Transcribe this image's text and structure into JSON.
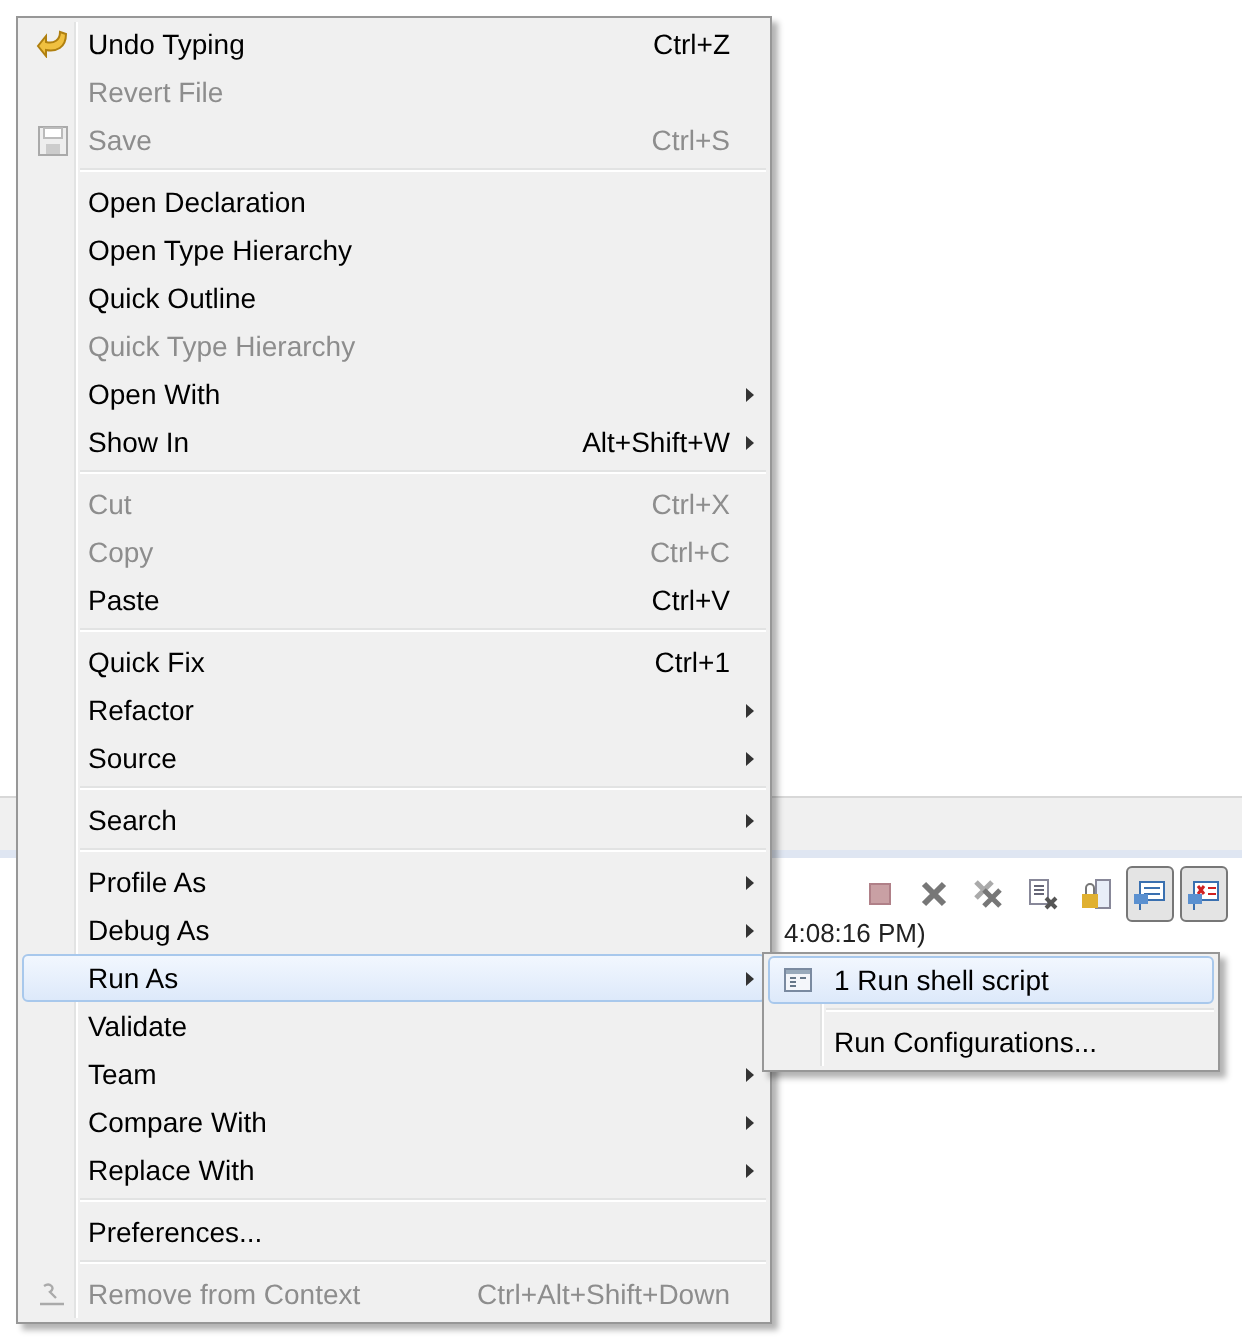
{
  "background": {
    "toolbar": [
      {
        "kind": "stop",
        "selected": false
      },
      {
        "kind": "remove",
        "selected": false
      },
      {
        "kind": "remove-all",
        "selected": false
      },
      {
        "kind": "doc",
        "selected": false
      },
      {
        "kind": "lock",
        "selected": false
      },
      {
        "kind": "console",
        "selected": true
      },
      {
        "kind": "console-error",
        "selected": true
      }
    ],
    "console_text": "4:08:16 PM)"
  },
  "menu": {
    "groups": [
      [
        {
          "label": "Undo Typing",
          "shortcut": "Ctrl+Z",
          "disabled": false,
          "submenu": false,
          "selected": false,
          "kind": "undo"
        },
        {
          "label": "Revert File",
          "disabled": true,
          "submenu": false,
          "selected": false,
          "kind": "plain"
        },
        {
          "label": "Save",
          "shortcut": "Ctrl+S",
          "disabled": true,
          "submenu": false,
          "selected": false,
          "kind": "save"
        }
      ],
      [
        {
          "label": "Open Declaration",
          "disabled": false,
          "submenu": false,
          "selected": false,
          "kind": "plain"
        },
        {
          "label": "Open Type Hierarchy",
          "disabled": false,
          "submenu": false,
          "selected": false,
          "kind": "plain"
        },
        {
          "label": "Quick Outline",
          "disabled": false,
          "submenu": false,
          "selected": false,
          "kind": "plain"
        },
        {
          "label": "Quick Type Hierarchy",
          "disabled": true,
          "submenu": false,
          "selected": false,
          "kind": "plain"
        },
        {
          "label": "Open With",
          "disabled": false,
          "submenu": true,
          "selected": false,
          "kind": "plain"
        },
        {
          "label": "Show In",
          "shortcut": "Alt+Shift+W",
          "disabled": false,
          "submenu": true,
          "selected": false,
          "kind": "plain"
        }
      ],
      [
        {
          "label": "Cut",
          "shortcut": "Ctrl+X",
          "disabled": true,
          "submenu": false,
          "selected": false,
          "kind": "plain"
        },
        {
          "label": "Copy",
          "shortcut": "Ctrl+C",
          "disabled": true,
          "submenu": false,
          "selected": false,
          "kind": "plain"
        },
        {
          "label": "Paste",
          "shortcut": "Ctrl+V",
          "disabled": false,
          "submenu": false,
          "selected": false,
          "kind": "plain"
        }
      ],
      [
        {
          "label": "Quick Fix",
          "shortcut": "Ctrl+1",
          "disabled": false,
          "submenu": false,
          "selected": false,
          "kind": "plain"
        },
        {
          "label": "Refactor",
          "disabled": false,
          "submenu": true,
          "selected": false,
          "kind": "plain"
        },
        {
          "label": "Source",
          "disabled": false,
          "submenu": true,
          "selected": false,
          "kind": "plain"
        }
      ],
      [
        {
          "label": "Search",
          "disabled": false,
          "submenu": true,
          "selected": false,
          "kind": "plain"
        }
      ],
      [
        {
          "label": "Profile As",
          "disabled": false,
          "submenu": true,
          "selected": false,
          "kind": "plain"
        },
        {
          "label": "Debug As",
          "disabled": false,
          "submenu": true,
          "selected": false,
          "kind": "plain"
        },
        {
          "label": "Run As",
          "disabled": false,
          "submenu": true,
          "selected": true,
          "kind": "plain"
        },
        {
          "label": "Validate",
          "disabled": false,
          "submenu": false,
          "selected": false,
          "kind": "plain"
        },
        {
          "label": "Team",
          "disabled": false,
          "submenu": true,
          "selected": false,
          "kind": "plain"
        },
        {
          "label": "Compare With",
          "disabled": false,
          "submenu": true,
          "selected": false,
          "kind": "plain"
        },
        {
          "label": "Replace With",
          "disabled": false,
          "submenu": true,
          "selected": false,
          "kind": "plain"
        }
      ],
      [
        {
          "label": "Preferences...",
          "disabled": false,
          "submenu": false,
          "selected": false,
          "kind": "plain"
        }
      ],
      [
        {
          "label": "Remove from Context",
          "shortcut": "Ctrl+Alt+Shift+Down",
          "disabled": true,
          "submenu": false,
          "selected": false,
          "kind": "remove-context"
        }
      ]
    ]
  },
  "submenu": {
    "groups": [
      [
        {
          "label": "1 Run shell script",
          "selected": true,
          "kind": "script"
        }
      ],
      [
        {
          "label": "Run Configurations...",
          "selected": false,
          "kind": "plain"
        }
      ]
    ]
  }
}
